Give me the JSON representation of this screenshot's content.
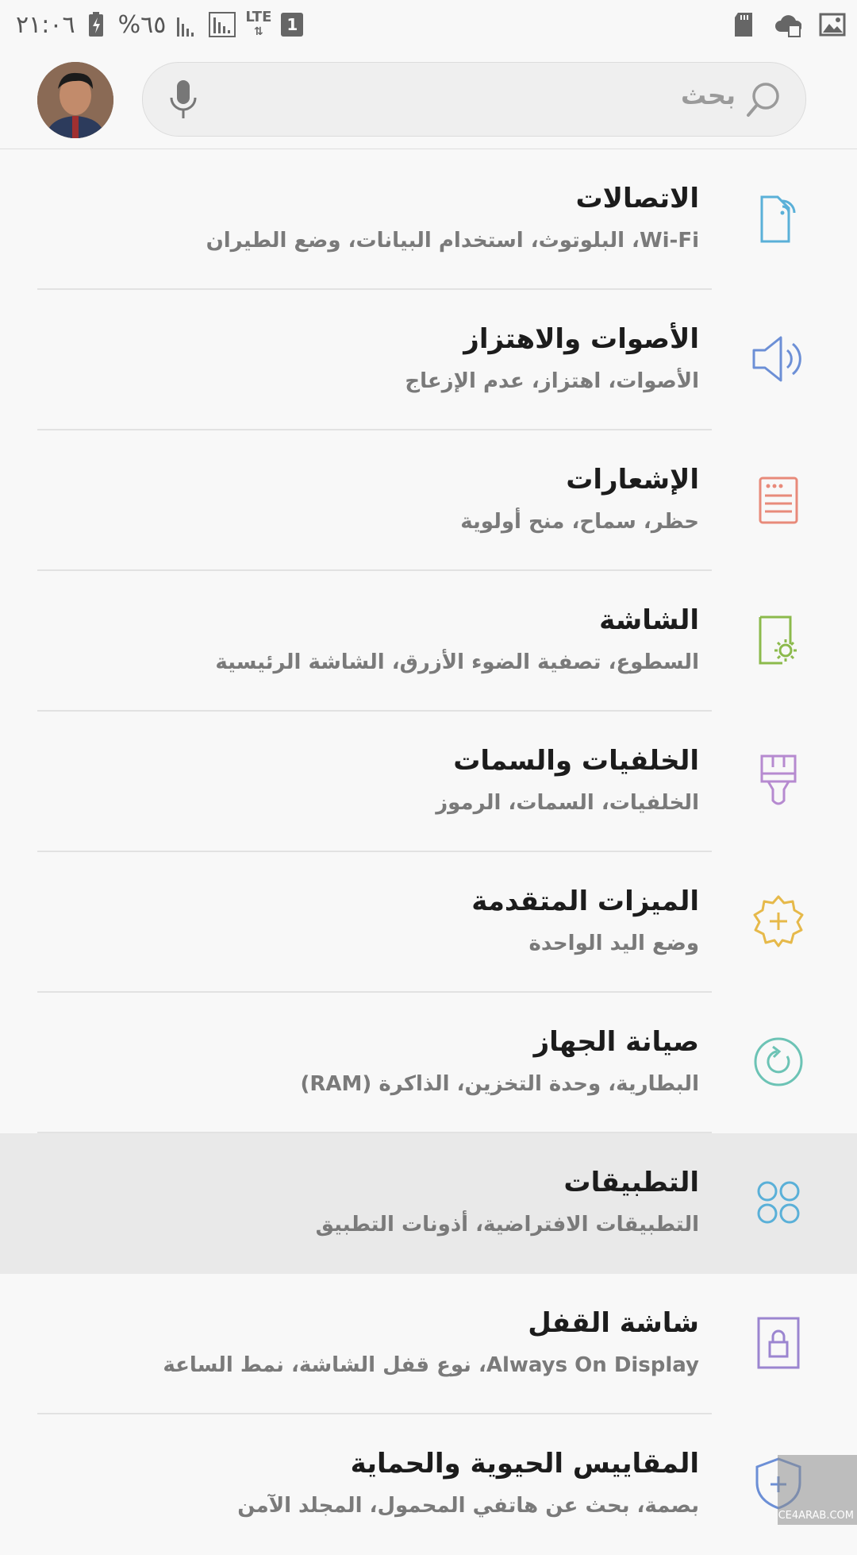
{
  "status": {
    "time": "٢١:٠٦",
    "battery_pct": "%٦٥",
    "network": "LTE",
    "sim": "1"
  },
  "search": {
    "label": "بحث"
  },
  "items": [
    {
      "title": "الاتصالات",
      "sub": "Wi-Fi، البلوتوث، استخدام البيانات، وضع الطيران",
      "icon": "connections-icon",
      "color": "#5ab0d8"
    },
    {
      "title": "الأصوات والاهتزاز",
      "sub": "الأصوات، اهتزاز، عدم الإزعاج",
      "icon": "speaker-icon",
      "color": "#6c8fd6"
    },
    {
      "title": "الإشعارات",
      "sub": "حظر، سماح، منح أولوية",
      "icon": "notifications-icon",
      "color": "#e88a7a"
    },
    {
      "title": "الشاشة",
      "sub": "السطوع، تصفية الضوء الأزرق، الشاشة الرئيسية",
      "icon": "display-icon",
      "color": "#8cba4c"
    },
    {
      "title": "الخلفيات والسمات",
      "sub": "الخلفيات، السمات، الرموز",
      "icon": "brush-icon",
      "color": "#b68ad0"
    },
    {
      "title": "الميزات المتقدمة",
      "sub": "وضع اليد الواحدة",
      "icon": "gear-plus-icon",
      "color": "#e6b94a"
    },
    {
      "title": "صيانة الجهاز",
      "sub": "البطارية، وحدة التخزين، الذاكرة (RAM)",
      "icon": "refresh-icon",
      "color": "#6cc3b5"
    },
    {
      "title": "التطبيقات",
      "sub": "التطبيقات الافتراضية، أذونات التطبيق",
      "icon": "apps-icon",
      "color": "#5ab0d8"
    },
    {
      "title": "شاشة القفل",
      "sub": "Always On Display، نوع قفل الشاشة، نمط الساعة",
      "icon": "lock-icon",
      "color": "#9b85d0"
    },
    {
      "title": "المقاييس الحيوية والحماية",
      "sub": "بصمة، بحث عن هاتفي المحمول، المجلد الآمن",
      "icon": "shield-icon",
      "color": "#6c8fd6"
    }
  ],
  "watermark": {
    "text": "CE4ARAB.COM"
  }
}
